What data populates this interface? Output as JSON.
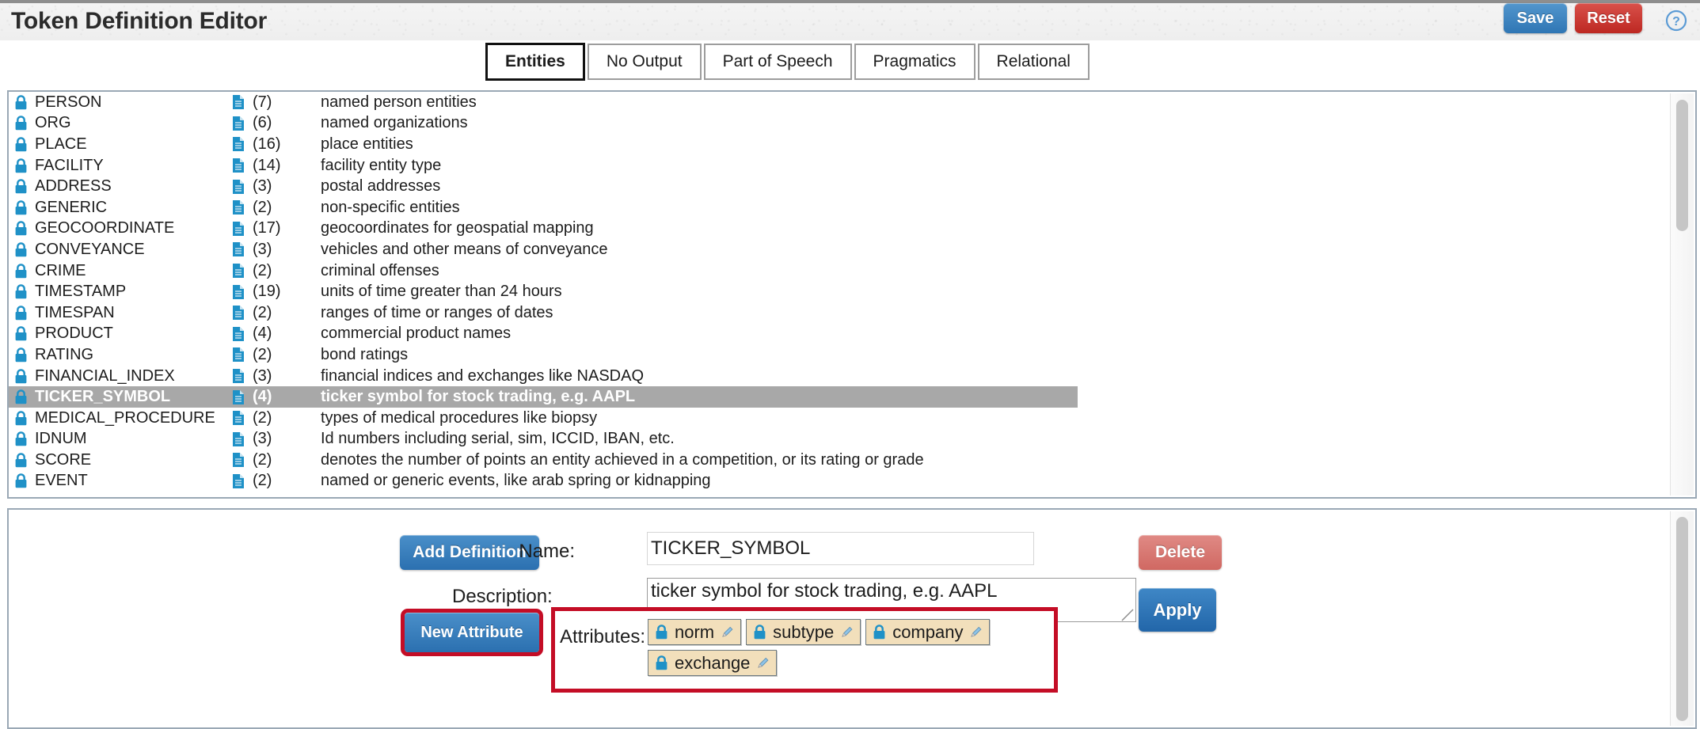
{
  "header": {
    "title": "Token Definition Editor",
    "save_label": "Save",
    "reset_label": "Reset",
    "help_icon": "help-circle-icon"
  },
  "tabs": [
    {
      "label": "Entities",
      "active": true
    },
    {
      "label": "No Output",
      "active": false
    },
    {
      "label": "Part of Speech",
      "active": false
    },
    {
      "label": "Pragmatics",
      "active": false
    },
    {
      "label": "Relational",
      "active": false
    }
  ],
  "list": {
    "lock_icon": "lock-icon",
    "doc_icon": "document-icon",
    "rows": [
      {
        "name": "PERSON",
        "count": "(7)",
        "description": "named person entities",
        "selected": false
      },
      {
        "name": "ORG",
        "count": "(6)",
        "description": "named organizations",
        "selected": false
      },
      {
        "name": "PLACE",
        "count": "(16)",
        "description": "place entities",
        "selected": false
      },
      {
        "name": "FACILITY",
        "count": "(14)",
        "description": "facility entity type",
        "selected": false
      },
      {
        "name": "ADDRESS",
        "count": "(3)",
        "description": "postal addresses",
        "selected": false
      },
      {
        "name": "GENERIC",
        "count": "(2)",
        "description": "non-specific entities",
        "selected": false
      },
      {
        "name": "GEOCOORDINATE",
        "count": "(17)",
        "description": "geocoordinates for geospatial mapping",
        "selected": false
      },
      {
        "name": "CONVEYANCE",
        "count": "(3)",
        "description": "vehicles and other means of conveyance",
        "selected": false
      },
      {
        "name": "CRIME",
        "count": "(2)",
        "description": "criminal offenses",
        "selected": false
      },
      {
        "name": "TIMESTAMP",
        "count": "(19)",
        "description": "units of time greater than 24 hours",
        "selected": false
      },
      {
        "name": "TIMESPAN",
        "count": "(2)",
        "description": "ranges of time or ranges of dates",
        "selected": false
      },
      {
        "name": "PRODUCT",
        "count": "(4)",
        "description": "commercial product names",
        "selected": false
      },
      {
        "name": "RATING",
        "count": "(2)",
        "description": "bond ratings",
        "selected": false
      },
      {
        "name": "FINANCIAL_INDEX",
        "count": "(3)",
        "description": "financial indices and exchanges like NASDAQ",
        "selected": false
      },
      {
        "name": "TICKER_SYMBOL",
        "count": "(4)",
        "description": "ticker symbol for stock trading, e.g. AAPL",
        "selected": true
      },
      {
        "name": "MEDICAL_PROCEDURE",
        "count": "(2)",
        "description": "types of medical procedures like biopsy",
        "selected": false
      },
      {
        "name": "IDNUM",
        "count": "(3)",
        "description": "Id numbers including serial, sim, ICCID, IBAN, etc.",
        "selected": false
      },
      {
        "name": "SCORE",
        "count": "(2)",
        "description": "denotes the number of points an entity achieved in a competition, or its rating or grade",
        "selected": false
      },
      {
        "name": "EVENT",
        "count": "(2)",
        "description": "named or generic events, like arab spring or kidnapping",
        "selected": false
      }
    ]
  },
  "editor": {
    "add_definition_label": "Add Definition",
    "delete_label": "Delete",
    "apply_label": "Apply",
    "new_attribute_label": "New Attribute",
    "name_label": "Name:",
    "name_value": "TICKER_SYMBOL",
    "description_label": "Description:",
    "description_value": "ticker symbol for stock trading, e.g. AAPL",
    "attributes_label": "Attributes:",
    "attributes": [
      {
        "label": "norm",
        "lock_icon": "lock-icon",
        "edit_icon": "pencil-icon"
      },
      {
        "label": "subtype",
        "lock_icon": "lock-icon",
        "edit_icon": "pencil-icon"
      },
      {
        "label": "company",
        "lock_icon": "lock-icon",
        "edit_icon": "pencil-icon"
      },
      {
        "label": "exchange",
        "lock_icon": "lock-icon",
        "edit_icon": "pencil-icon"
      }
    ]
  },
  "colors": {
    "accent_blue": "#2b70b0",
    "danger_red": "#bd2822",
    "highlight_red": "#c40d26",
    "selection_gray": "#a8a8a8",
    "chip_tan": "#f2dfbb",
    "icon_blue": "#1f91c7"
  }
}
